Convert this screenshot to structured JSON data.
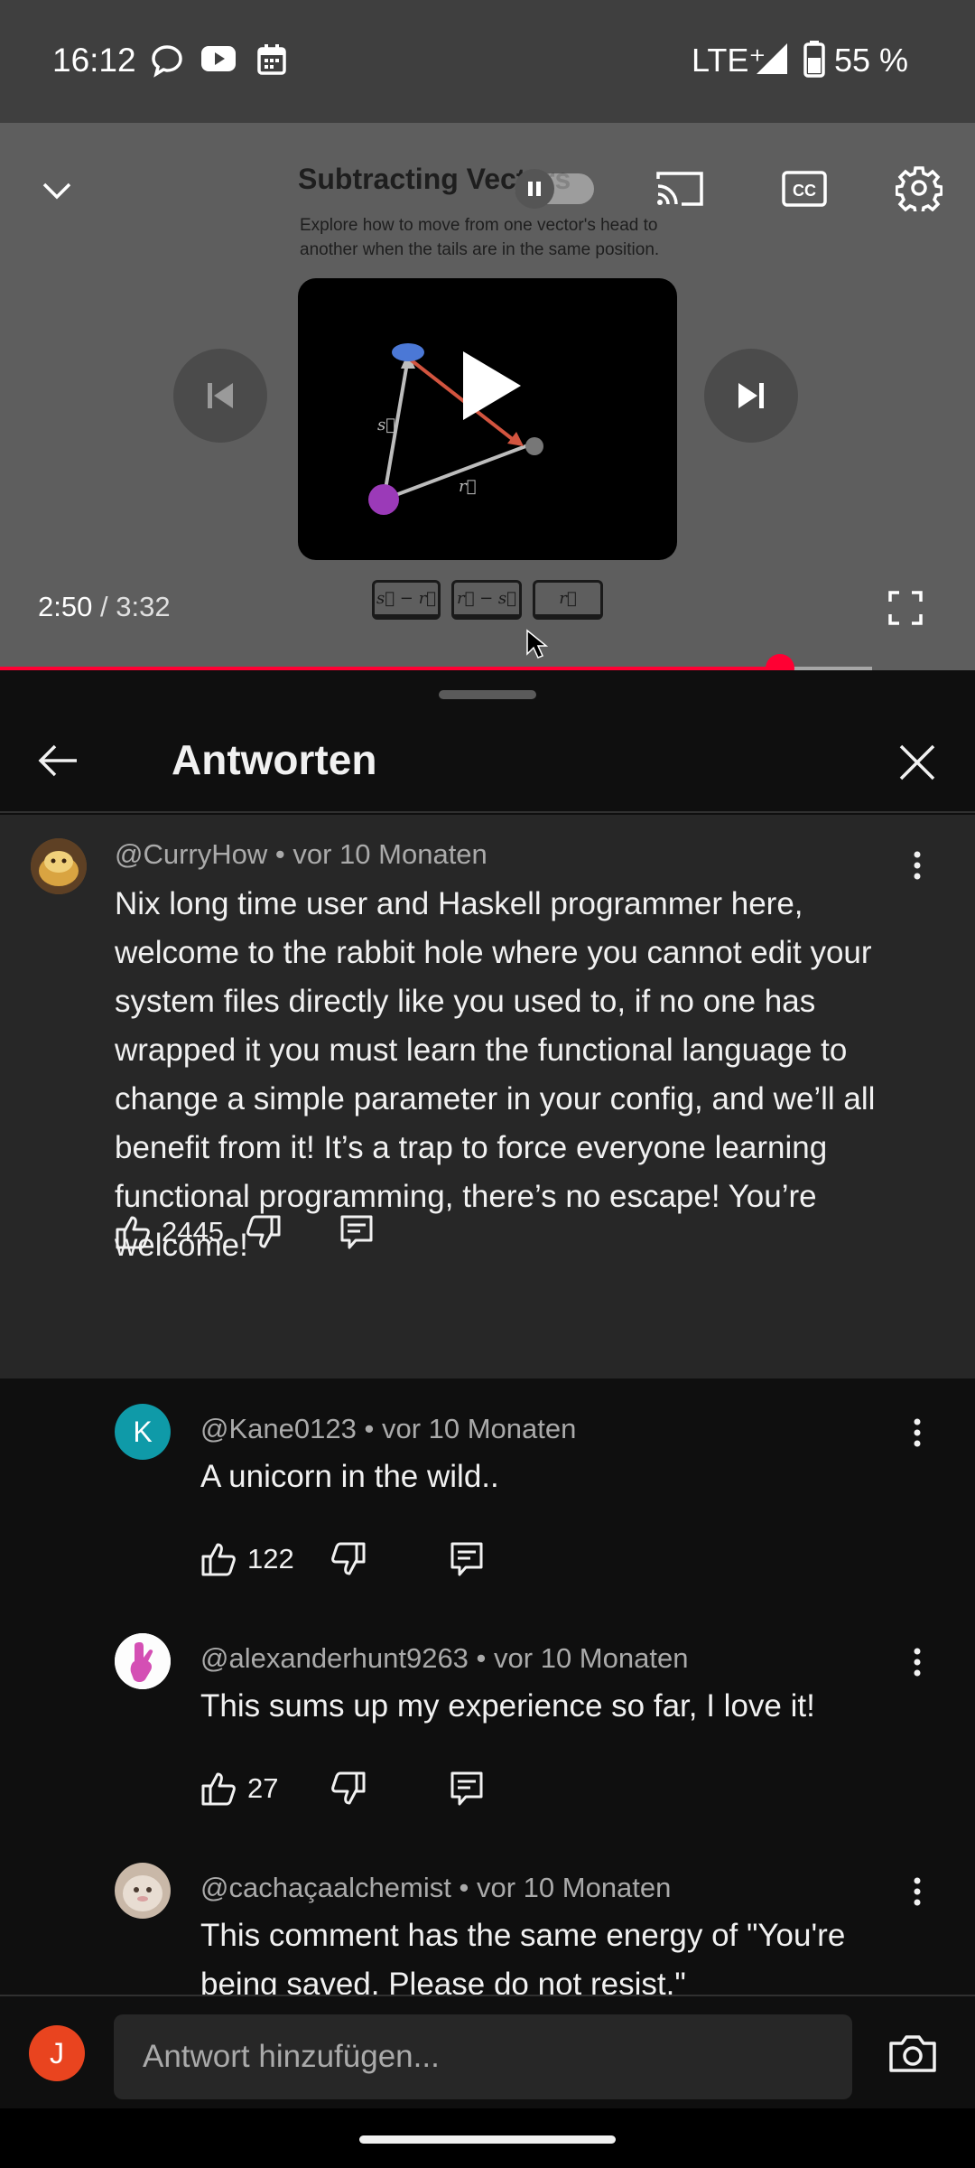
{
  "status_bar": {
    "time": "16:12",
    "network": "LTE⁺",
    "battery": "55 %",
    "icons": [
      "chat-bubble-icon",
      "youtube-icon",
      "calendar-icon",
      "signal-icon",
      "battery-icon"
    ]
  },
  "player": {
    "slide_title": "Subtracting Vectors",
    "slide_subtitle": "Explore how to move from one vector's head to another when the tails are in the same position.",
    "slide_formulas": [
      "s⃗ − r⃗",
      "r⃗ − s⃗",
      "r⃗"
    ],
    "slide_vector_labels": [
      "s⃗",
      "r⃗"
    ],
    "current_time": "2:50",
    "separator": "/",
    "duration": "3:32",
    "progress": 0.8,
    "buffered": 0.894,
    "state": "playing-paused-overlay"
  },
  "panel": {
    "title": "Antworten"
  },
  "parent_comment": {
    "author": "@CurryHow",
    "age": "vor 10 Monaten",
    "text": "Nix long time user and Haskell programmer here, welcome to the rabbit hole where you cannot edit your system files directly like you used to, if no one has wrapped it you must learn the functional language to change a simple parameter in your config, and we’ll all benefit from it! It’s a trap to force everyone learning functional programming, there’s no escape! You’re welcome!",
    "likes": "2445"
  },
  "replies": [
    {
      "author": "@Kane0123",
      "age": "vor 10 Monaten",
      "text": "A unicorn in the wild..",
      "likes": "122",
      "avatar_letter": "K",
      "avatar_color": "#0f9aa8"
    },
    {
      "author": "@alexanderhunt9263",
      "age": "vor 10 Monaten",
      "text": "This sums up my experience so far, I love it!",
      "likes": "27"
    },
    {
      "author": "@cachaçaalchemist",
      "age": "vor 10 Monaten",
      "text": "This comment has the same energy of \"You're being saved. Please do not resist.\""
    }
  ],
  "meta_separator": "•",
  "composer": {
    "user_initial": "J",
    "user_color": "#e9441f",
    "placeholder": "Antwort hinzufügen..."
  },
  "colors": {
    "accent": "#ff0033",
    "background": "#0f0f0f",
    "surface": "#272727",
    "secondary_text": "#aaaaaa"
  }
}
